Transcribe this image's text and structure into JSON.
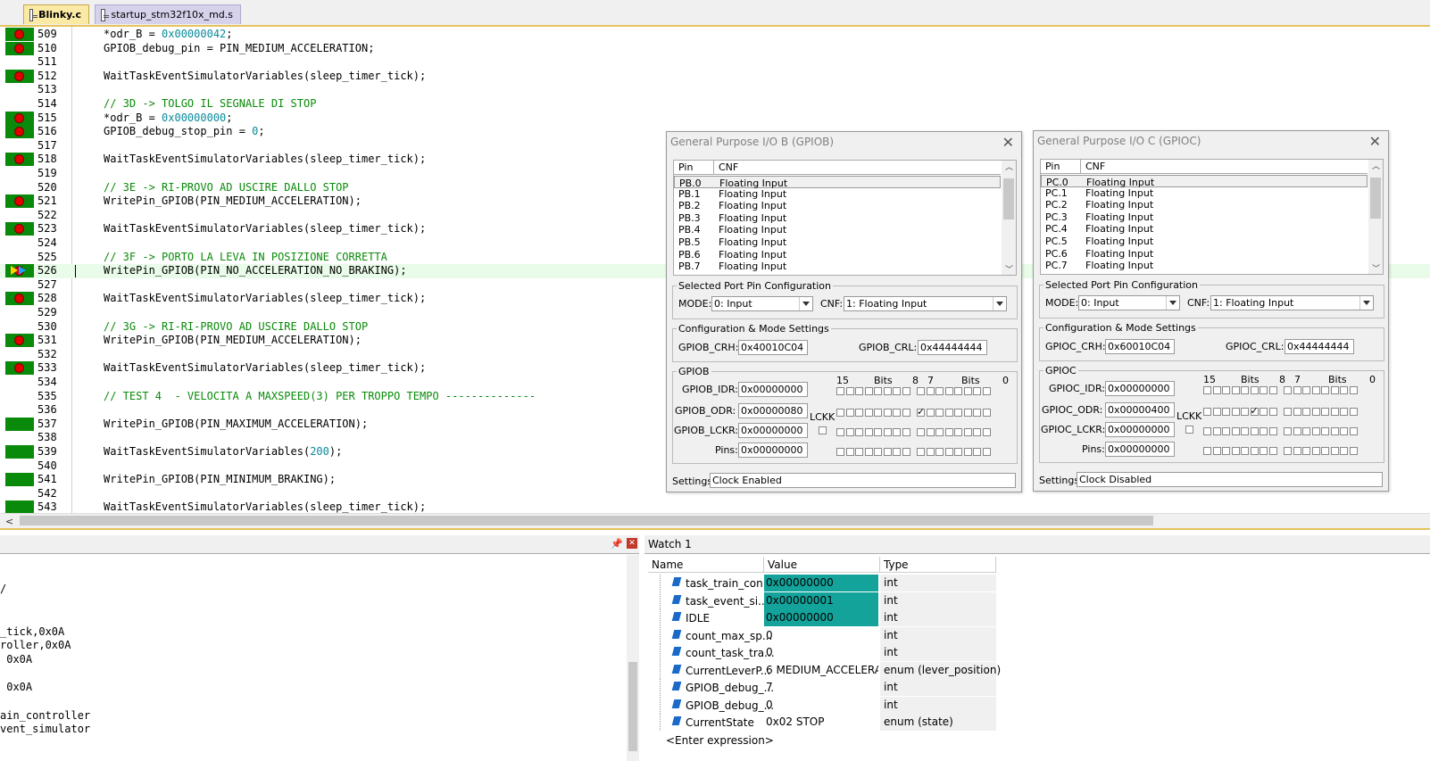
{
  "tabs": [
    {
      "label": "Blinky.c"
    },
    {
      "label": "startup_stm32f10x_md.s"
    }
  ],
  "editor": {
    "lines": [
      {
        "n": "509",
        "bp": "red",
        "code": [
          [
            "",
            "*odr_B = "
          ],
          [
            "n",
            "0x00000042"
          ],
          [
            "",
            ";"
          ]
        ]
      },
      {
        "n": "510",
        "bp": "red",
        "code": [
          [
            "",
            "GPIOB_debug_pin = PIN_MEDIUM_ACCELERATION;"
          ]
        ]
      },
      {
        "n": "511",
        "bp": "none",
        "code": []
      },
      {
        "n": "512",
        "bp": "red",
        "code": [
          [
            "",
            "WaitTaskEventSimulatorVariables(sleep_timer_tick);"
          ]
        ]
      },
      {
        "n": "513",
        "bp": "none",
        "code": []
      },
      {
        "n": "514",
        "bp": "none",
        "code": [
          [
            "c",
            "// 3D -> TOLGO IL SEGNALE DI STOP"
          ]
        ]
      },
      {
        "n": "515",
        "bp": "red",
        "code": [
          [
            "",
            "*odr_B = "
          ],
          [
            "n",
            "0x00000000"
          ],
          [
            "",
            ";"
          ]
        ]
      },
      {
        "n": "516",
        "bp": "red",
        "code": [
          [
            "",
            "GPIOB_debug_stop_pin = "
          ],
          [
            "n",
            "0"
          ],
          [
            "",
            ";"
          ]
        ]
      },
      {
        "n": "517",
        "bp": "none",
        "code": []
      },
      {
        "n": "518",
        "bp": "red",
        "code": [
          [
            "",
            "WaitTaskEventSimulatorVariables(sleep_timer_tick);"
          ]
        ]
      },
      {
        "n": "519",
        "bp": "none",
        "code": []
      },
      {
        "n": "520",
        "bp": "none",
        "code": [
          [
            "c",
            "// 3E -> RI-PROVO AD USCIRE DALLO STOP"
          ]
        ]
      },
      {
        "n": "521",
        "bp": "red",
        "code": [
          [
            "",
            "WritePin_GPIOB(PIN_MEDIUM_ACCELERATION);"
          ]
        ]
      },
      {
        "n": "522",
        "bp": "none",
        "code": []
      },
      {
        "n": "523",
        "bp": "red",
        "code": [
          [
            "",
            "WaitTaskEventSimulatorVariables(sleep_timer_tick);"
          ]
        ]
      },
      {
        "n": "524",
        "bp": "none",
        "code": []
      },
      {
        "n": "525",
        "bp": "none",
        "code": [
          [
            "c",
            "// 3F -> PORTO LA LEVA IN POSIZIONE CORRETTA"
          ]
        ]
      },
      {
        "n": "526",
        "bp": "current",
        "code": [
          [
            "",
            "WritePin_GPIOB(PIN_NO_ACCELERATION_NO_BRAKING);"
          ]
        ]
      },
      {
        "n": "527",
        "bp": "none",
        "code": []
      },
      {
        "n": "528",
        "bp": "red",
        "code": [
          [
            "",
            "WaitTaskEventSimulatorVariables(sleep_timer_tick);"
          ]
        ]
      },
      {
        "n": "529",
        "bp": "none",
        "code": []
      },
      {
        "n": "530",
        "bp": "none",
        "code": [
          [
            "c",
            "// 3G -> RI-RI-PROVO AD USCIRE DALLO STOP"
          ]
        ]
      },
      {
        "n": "531",
        "bp": "red",
        "code": [
          [
            "",
            "WritePin_GPIOB(PIN_MEDIUM_ACCELERATION);"
          ]
        ]
      },
      {
        "n": "532",
        "bp": "none",
        "code": []
      },
      {
        "n": "533",
        "bp": "red",
        "code": [
          [
            "",
            "WaitTaskEventSimulatorVariables(sleep_timer_tick);"
          ]
        ]
      },
      {
        "n": "534",
        "bp": "none",
        "code": []
      },
      {
        "n": "535",
        "bp": "none",
        "code": [
          [
            "c",
            "// TEST 4  - VELOCITA A MAXSPEED(3) PER TROPPO TEMPO --------------"
          ]
        ]
      },
      {
        "n": "536",
        "bp": "none",
        "code": []
      },
      {
        "n": "537",
        "bp": "green",
        "code": [
          [
            "",
            "WritePin_GPIOB(PIN_MAXIMUM_ACCELERATION);"
          ]
        ]
      },
      {
        "n": "538",
        "bp": "none",
        "code": []
      },
      {
        "n": "539",
        "bp": "green",
        "code": [
          [
            "",
            "WaitTaskEventSimulatorVariables("
          ],
          [
            "n",
            "200"
          ],
          [
            "",
            ");"
          ]
        ]
      },
      {
        "n": "540",
        "bp": "none",
        "code": []
      },
      {
        "n": "541",
        "bp": "green",
        "code": [
          [
            "",
            "WritePin_GPIOB(PIN_MINIMUM_BRAKING);"
          ]
        ]
      },
      {
        "n": "542",
        "bp": "none",
        "code": []
      },
      {
        "n": "543",
        "bp": "green",
        "code": [
          [
            "",
            "WaitTaskEventSimulatorVariables(sleep_timer_tick);"
          ]
        ]
      }
    ]
  },
  "gpiob": {
    "title": "General Purpose I/O B (GPIOB)",
    "col_pin": "Pin",
    "col_cnf": "CNF",
    "pins": [
      [
        "PB.0",
        "Floating Input"
      ],
      [
        "PB.1",
        "Floating Input"
      ],
      [
        "PB.2",
        "Floating Input"
      ],
      [
        "PB.3",
        "Floating Input"
      ],
      [
        "PB.4",
        "Floating Input"
      ],
      [
        "PB.5",
        "Floating Input"
      ],
      [
        "PB.6",
        "Floating Input"
      ],
      [
        "PB.7",
        "Floating Input"
      ]
    ],
    "sel_legend": "Selected Port Pin Configuration",
    "mode_label": "MODE:",
    "mode_value": "0: Input",
    "cnf_label": "CNF:",
    "cnf_value": "1: Floating Input",
    "cfg_legend": "Configuration & Mode Settings",
    "crh_label": "GPIOB_CRH:",
    "crh_value": "0x40010C04",
    "crl_label": "GPIOB_CRL:",
    "crl_value": "0x44444444",
    "grp_legend": "GPIOB",
    "bits_15": "15",
    "bits_label": "Bits",
    "bits_8": "8",
    "bits_7": "7",
    "bits_0": "0",
    "idr_label": "GPIOB_IDR:",
    "idr_value": "0x00000000",
    "odr_label": "GPIOB_ODR:",
    "odr_value": "0x00000080",
    "lckr_label": "GPIOB_LCKR:",
    "lckr_value": "0x00000000",
    "pins_label": "Pins:",
    "pins_value": "0x00000000",
    "lckk_label": "LCKK",
    "settings_label": "Settings:",
    "settings_value": "Clock Enabled",
    "odr_checked_bit": 7
  },
  "gpioc": {
    "title": "General Purpose I/O C (GPIOC)",
    "col_pin": "Pin",
    "col_cnf": "CNF",
    "pins": [
      [
        "PC.0",
        "Floating Input"
      ],
      [
        "PC.1",
        "Floating Input"
      ],
      [
        "PC.2",
        "Floating Input"
      ],
      [
        "PC.3",
        "Floating Input"
      ],
      [
        "PC.4",
        "Floating Input"
      ],
      [
        "PC.5",
        "Floating Input"
      ],
      [
        "PC.6",
        "Floating Input"
      ],
      [
        "PC.7",
        "Floating Input"
      ]
    ],
    "sel_legend": "Selected Port Pin Configuration",
    "mode_label": "MODE:",
    "mode_value": "0: Input",
    "cnf_label": "CNF:",
    "cnf_value": "1: Floating Input",
    "cfg_legend": "Configuration & Mode Settings",
    "crh_label": "GPIOC_CRH:",
    "crh_value": "0x60010C04",
    "crl_label": "GPIOC_CRL:",
    "crl_value": "0x44444444",
    "grp_legend": "GPIOC",
    "bits_15": "15",
    "bits_label": "Bits",
    "bits_8": "8",
    "bits_7": "7",
    "bits_0": "0",
    "idr_label": "GPIOC_IDR:",
    "idr_value": "0x00000000",
    "odr_label": "GPIOC_ODR:",
    "odr_value": "0x00000400",
    "lckr_label": "GPIOC_LCKR:",
    "lckr_value": "0x00000000",
    "pins_label": "Pins:",
    "pins_value": "0x00000000",
    "lckk_label": "LCKK",
    "settings_label": "Settings:",
    "settings_value": "Clock Disabled",
    "odr_checked_bit": 10
  },
  "left_panel": {
    "lines": [
      "",
      "",
      "/",
      "",
      "",
      "_tick,0x0A",
      "roller,0x0A",
      " 0x0A",
      "",
      " 0x0A",
      "",
      "ain_controller",
      "vent_simulator"
    ]
  },
  "watch": {
    "title": "Watch 1",
    "col_name": "Name",
    "col_value": "Value",
    "col_type": "Type",
    "rows": [
      {
        "name": "task_train_con...",
        "value": "0x00000000",
        "type": "int",
        "hl": true
      },
      {
        "name": "task_event_si...",
        "value": "0x00000001",
        "type": "int",
        "hl": true
      },
      {
        "name": "IDLE",
        "value": "0x00000000",
        "type": "int",
        "hl": true
      },
      {
        "name": "count_max_sp...",
        "value": "0",
        "type": "int",
        "hl": false
      },
      {
        "name": "count_task_tra...",
        "value": "0",
        "type": "int",
        "hl": false
      },
      {
        "name": "CurrentLeverP...",
        "value": "6 MEDIUM_ACCELERA...",
        "type": "enum (lever_position)",
        "hl": false
      },
      {
        "name": "GPIOB_debug_...",
        "value": "7",
        "type": "int",
        "hl": false
      },
      {
        "name": "GPIOB_debug_...",
        "value": "0",
        "type": "int",
        "hl": false
      },
      {
        "name": "CurrentState",
        "value": "0x02 STOP",
        "type": "enum (state)",
        "hl": false
      }
    ],
    "enter_expr": "<Enter expression>"
  }
}
